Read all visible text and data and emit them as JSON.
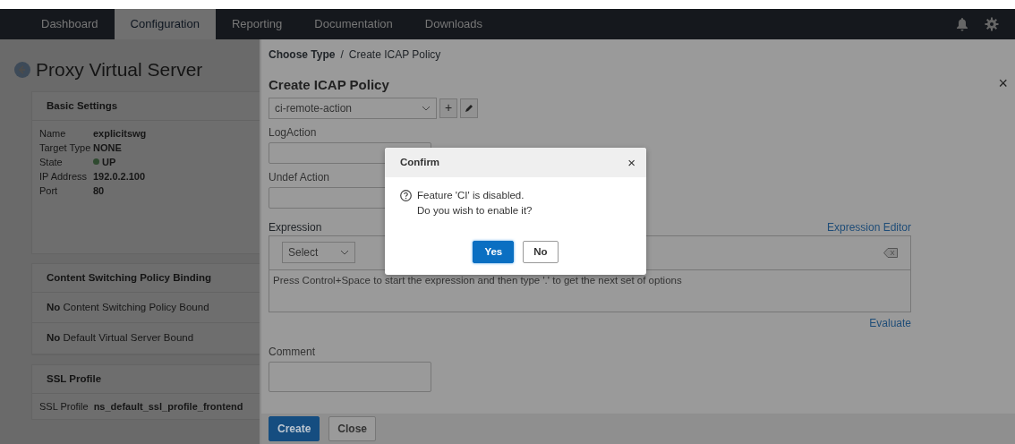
{
  "nav": {
    "tabs": [
      {
        "label": "Dashboard",
        "selected": false
      },
      {
        "label": "Configuration",
        "selected": true
      },
      {
        "label": "Reporting",
        "selected": false
      },
      {
        "label": "Documentation",
        "selected": false
      },
      {
        "label": "Downloads",
        "selected": false
      }
    ]
  },
  "server": {
    "title": "Proxy Virtual Server",
    "basic": {
      "heading": "Basic Settings",
      "rows": [
        {
          "key": "Name",
          "value": "explicitswg",
          "kind": "text"
        },
        {
          "key": "Target Type",
          "value": "NONE",
          "kind": "text"
        },
        {
          "key": "State",
          "value": "UP",
          "kind": "status"
        },
        {
          "key": "IP Address",
          "value": "192.0.2.100",
          "kind": "text"
        },
        {
          "key": "Port",
          "value": "80",
          "kind": "text"
        }
      ]
    },
    "binding": {
      "heading": "Content Switching Policy Binding",
      "lines": [
        "**No** Content Switching Policy Bound",
        "**No** Default Virtual Server Bound"
      ]
    },
    "ssl": {
      "heading": "SSL Profile",
      "key": "SSL Profile",
      "value": "ns_default_ssl_profile_frontend"
    }
  },
  "panel": {
    "breadcrumb": {
      "link": "Choose Type",
      "separator": "/",
      "current": "Create ICAP Policy"
    },
    "title": "Create ICAP Policy",
    "close": "×",
    "action": {
      "value": "ci-remote-action",
      "add": "+"
    },
    "log_action": {
      "label": "LogAction"
    },
    "undef_action": {
      "label": "Undef Action"
    },
    "expression": {
      "label": "Expression",
      "editor_link": "Expression Editor",
      "select": "Select",
      "hint": "Press Control+Space to start the expression and then type '.' to get the next set of options",
      "evaluate": "Evaluate"
    },
    "comment": {
      "label": "Comment"
    },
    "buttons": [
      {
        "label": "Create",
        "kind": "primary"
      },
      {
        "label": "Close",
        "kind": "secondary"
      }
    ]
  },
  "dialog": {
    "title": "Confirm",
    "close": "×",
    "lines": [
      "Feature 'CI' is disabled.",
      "Do you wish to enable it?"
    ],
    "buttons": [
      {
        "label": "Yes",
        "kind": "primary"
      },
      {
        "label": "No",
        "kind": "secondary"
      }
    ]
  }
}
